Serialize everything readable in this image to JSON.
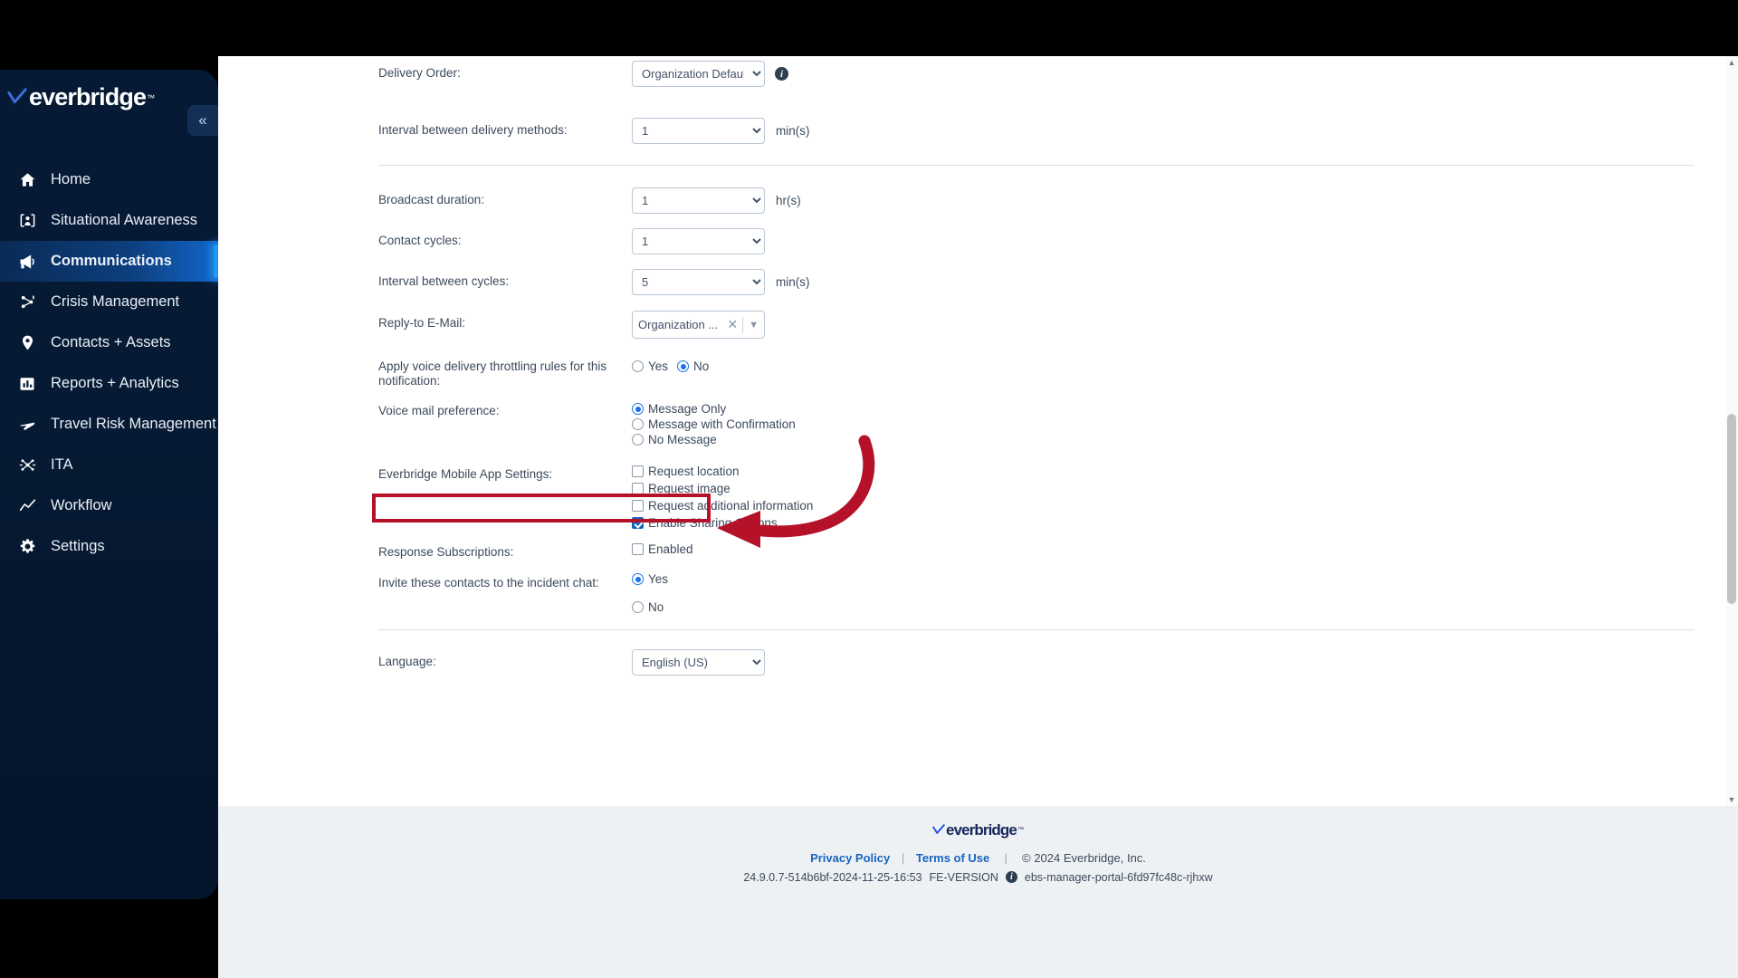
{
  "brand": {
    "name": "everbridge",
    "tm": "™",
    "accent_blue": "#2196f3",
    "sidebar_bg": "#061a36",
    "highlight_red": "#b5122a"
  },
  "sidebar": {
    "collapse_label": "«",
    "items": [
      {
        "label": "Home",
        "icon": "home-icon",
        "active": false
      },
      {
        "label": "Situational Awareness",
        "icon": "situational-awareness-icon",
        "active": false
      },
      {
        "label": "Communications",
        "icon": "megaphone-icon",
        "active": true
      },
      {
        "label": "Crisis Management",
        "icon": "crisis-management-icon",
        "active": false
      },
      {
        "label": "Contacts + Assets",
        "icon": "location-pin-icon",
        "active": false
      },
      {
        "label": "Reports + Analytics",
        "icon": "bar-chart-icon",
        "active": false
      },
      {
        "label": "Travel Risk Management",
        "icon": "airplane-icon",
        "active": false
      },
      {
        "label": "ITA",
        "icon": "ita-network-icon",
        "active": false
      },
      {
        "label": "Workflow",
        "icon": "workflow-line-icon",
        "active": false
      },
      {
        "label": "Settings",
        "icon": "gear-icon",
        "active": false
      }
    ]
  },
  "form": {
    "delivery_order": {
      "label": "Delivery Order:",
      "value": "Organization Default",
      "options": [
        "Organization Default"
      ],
      "info_icon": "info-icon"
    },
    "interval_delivery_methods": {
      "label": "Interval between delivery methods:",
      "value": "1",
      "options": [
        "1"
      ],
      "unit": "min(s)"
    },
    "broadcast_duration": {
      "label": "Broadcast duration:",
      "value": "1",
      "options": [
        "1"
      ],
      "unit": "hr(s)"
    },
    "contact_cycles": {
      "label": "Contact cycles:",
      "value": "1",
      "options": [
        "1"
      ]
    },
    "interval_between_cycles": {
      "label": "Interval between cycles:",
      "value": "5",
      "options": [
        "5"
      ],
      "unit": "min(s)"
    },
    "reply_to_email": {
      "label": "Reply-to E-Mail:",
      "value": "Organization ...",
      "clear_icon": "close-icon",
      "caret_icon": "chevron-down-icon"
    },
    "voice_throttling": {
      "label": "Apply voice delivery throttling rules for this notification:",
      "options": [
        {
          "label": "Yes",
          "selected": false
        },
        {
          "label": "No",
          "selected": true
        }
      ]
    },
    "voice_mail_preference": {
      "label": "Voice mail preference:",
      "options": [
        {
          "label": "Message Only",
          "selected": true
        },
        {
          "label": "Message with Confirmation",
          "selected": false
        },
        {
          "label": "No Message",
          "selected": false
        }
      ]
    },
    "mobile_app_settings": {
      "label": "Everbridge Mobile App Settings:",
      "options": [
        {
          "label": "Request location",
          "checked": false
        },
        {
          "label": "Request image",
          "checked": false
        },
        {
          "label": "Request additional information",
          "checked": false
        },
        {
          "label": "Enable Sharing Options",
          "checked": true
        }
      ]
    },
    "response_subscriptions": {
      "label": "Response Subscriptions:",
      "options": [
        {
          "label": "Enabled",
          "checked": false
        }
      ]
    },
    "incident_chat": {
      "label": "Invite these contacts to the incident chat:",
      "options": [
        {
          "label": "Yes",
          "selected": true
        },
        {
          "label": "No",
          "selected": false
        }
      ]
    },
    "language": {
      "label": "Language:",
      "value": "English (US)",
      "options": [
        "English (US)"
      ]
    }
  },
  "footer": {
    "privacy_policy": "Privacy Policy",
    "separator": "|",
    "terms_of_use": "Terms of Use",
    "copyright": "© 2024 Everbridge, Inc.",
    "build_version": "24.9.0.7-514b6bf-2024-11-25-16:53",
    "fe_version_label": "FE-VERSION",
    "fe_info_icon": "info-icon",
    "fe_version_value": "ebs-manager-portal-6fd97fc48c-rjhxw"
  },
  "scrollbar": {
    "up_arrow": "▲",
    "down_arrow": "▼"
  }
}
